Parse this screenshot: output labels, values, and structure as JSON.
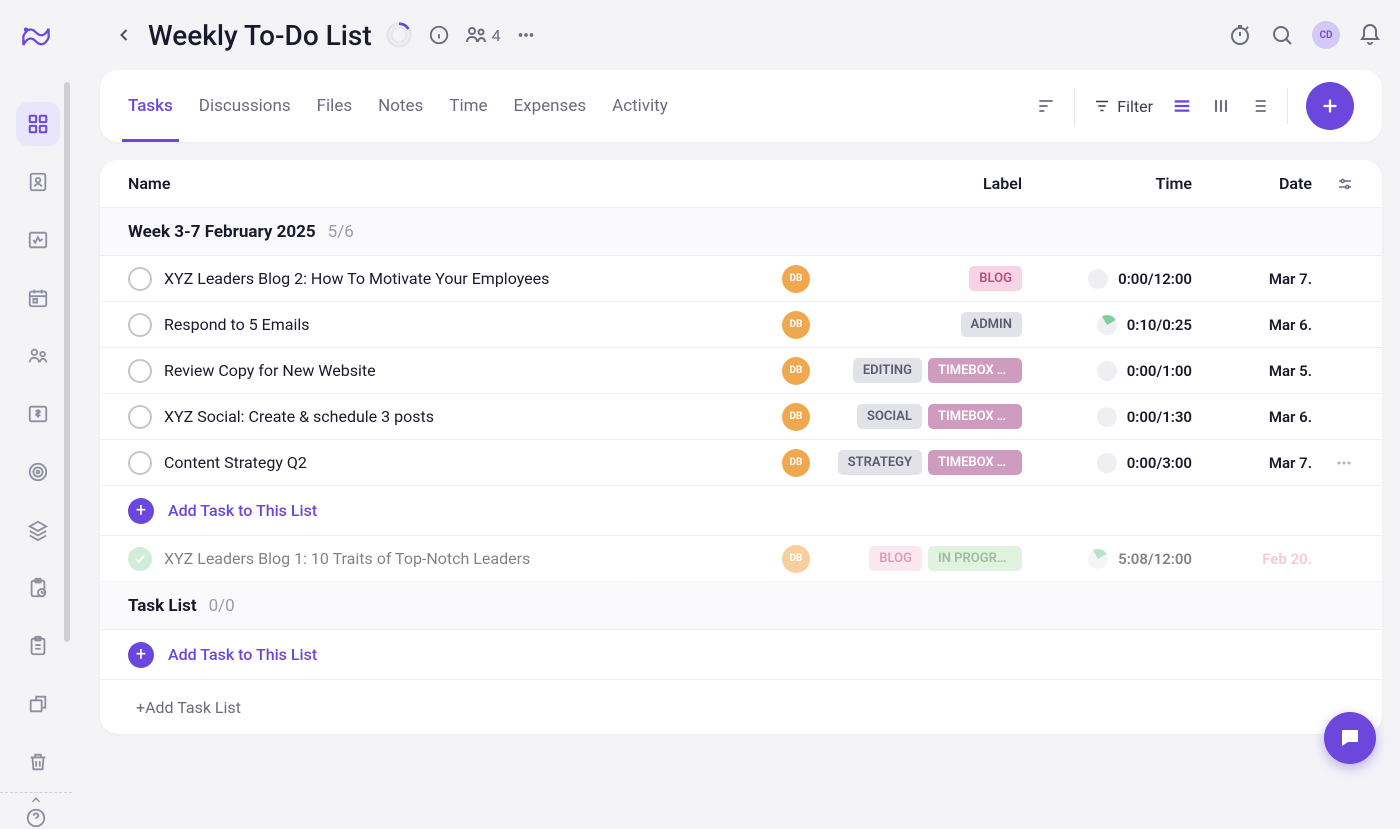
{
  "header": {
    "title": "Weekly To-Do List",
    "people_count": "4"
  },
  "avatar": {
    "initials": "CD"
  },
  "tabs": {
    "items": [
      {
        "label": "Tasks",
        "active": true
      },
      {
        "label": "Discussions"
      },
      {
        "label": "Files"
      },
      {
        "label": "Notes"
      },
      {
        "label": "Time"
      },
      {
        "label": "Expenses"
      },
      {
        "label": "Activity"
      }
    ],
    "filter_label": "Filter"
  },
  "columns": {
    "name": "Name",
    "label": "Label",
    "time": "Time",
    "date": "Date"
  },
  "groups": [
    {
      "title": "Week  3-7 February 2025",
      "count": "5/6",
      "tasks": [
        {
          "name": "XYZ Leaders Blog 2: How To Motivate Your Employees",
          "assignee": "DB",
          "labels": [
            {
              "text": "BLOG",
              "cls": "lbl-blog"
            }
          ],
          "time": "0:00/12:00",
          "ring": "",
          "date": "Mar 7."
        },
        {
          "name": "Respond to 5 Emails",
          "assignee": "DB",
          "labels": [
            {
              "text": "ADMIN",
              "cls": "lbl-admin"
            }
          ],
          "time": "0:10/0:25",
          "ring": "slice",
          "date": "Mar 6."
        },
        {
          "name": "Review Copy for New Website",
          "assignee": "DB",
          "labels": [
            {
              "text": "EDITING",
              "cls": "lbl-editing"
            },
            {
              "text": "TIMEBOX T…",
              "cls": "lbl-timebox"
            }
          ],
          "time": "0:00/1:00",
          "ring": "",
          "date": "Mar 5."
        },
        {
          "name": "XYZ Social: Create & schedule 3 posts",
          "assignee": "DB",
          "labels": [
            {
              "text": "SOCIAL",
              "cls": "lbl-social"
            },
            {
              "text": "TIMEBOX T…",
              "cls": "lbl-timebox"
            }
          ],
          "time": "0:00/1:30",
          "ring": "",
          "date": "Mar 6."
        },
        {
          "name": "Content Strategy Q2",
          "assignee": "DB",
          "labels": [
            {
              "text": "STRATEGY",
              "cls": "lbl-strategy"
            },
            {
              "text": "TIMEBOX T…",
              "cls": "lbl-timebox"
            }
          ],
          "time": "0:00/3:00",
          "ring": "",
          "date": "Mar 7.",
          "more": true
        }
      ],
      "add_label": "Add Task to This List",
      "completed": [
        {
          "name": "XYZ Leaders Blog 1: 10 Traits of Top-Notch Leaders",
          "assignee": "DB",
          "labels": [
            {
              "text": "BLOG",
              "cls": "lbl-blog"
            },
            {
              "text": "IN PROGRE…",
              "cls": "lbl-inprogress"
            }
          ],
          "time": "5:08/12:00",
          "ring": "slice",
          "date": "Feb 20.",
          "overdue": true
        }
      ]
    },
    {
      "title": "Task List",
      "count": "0/0",
      "tasks": [],
      "add_label": "Add Task to This List"
    }
  ],
  "add_list_label": "+Add Task List"
}
